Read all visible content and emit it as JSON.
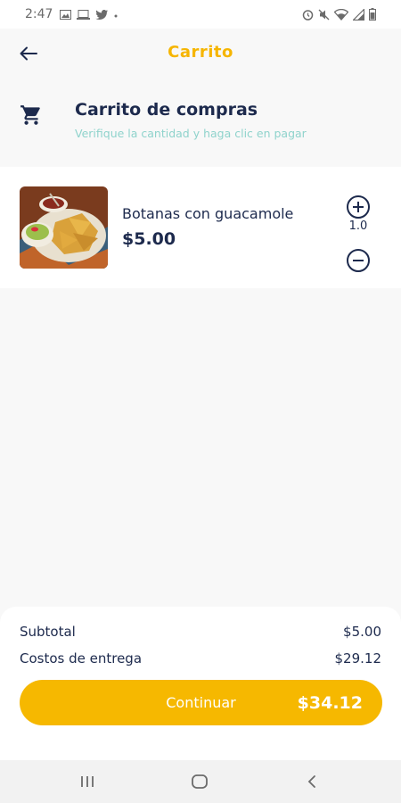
{
  "status_bar": {
    "time": "2:47",
    "left_icons": [
      "image-icon",
      "laptop-icon",
      "twitter-icon",
      "dot-icon"
    ],
    "right_icons": [
      "alarm-icon",
      "mute-icon",
      "wifi-icon",
      "signal-icon",
      "battery-icon"
    ]
  },
  "header": {
    "title": "Carrito",
    "back_icon": "arrow-left-icon"
  },
  "section": {
    "title": "Carrito de compras",
    "subtitle": "Verifique la cantidad y haga clic en pagar",
    "icon": "shopping-cart-icon"
  },
  "cart": {
    "items": [
      {
        "name": "Botanas con guacamole",
        "price": "$5.00",
        "quantity": "1.0",
        "image": "nachos-guacamole-photo"
      }
    ]
  },
  "summary": {
    "subtotal_label": "Subtotal",
    "subtotal_value": "$5.00",
    "delivery_label": "Costos de entrega",
    "delivery_value": "$29.12",
    "continue_label": "Continuar",
    "total": "$34.12"
  },
  "colors": {
    "accent": "#f6b800",
    "title": "#1d2a4d",
    "subtitle": "#8fd3cc",
    "background": "#f8f8f8"
  },
  "nav": {
    "icons": [
      "recent-apps-icon",
      "home-icon",
      "back-icon"
    ]
  }
}
